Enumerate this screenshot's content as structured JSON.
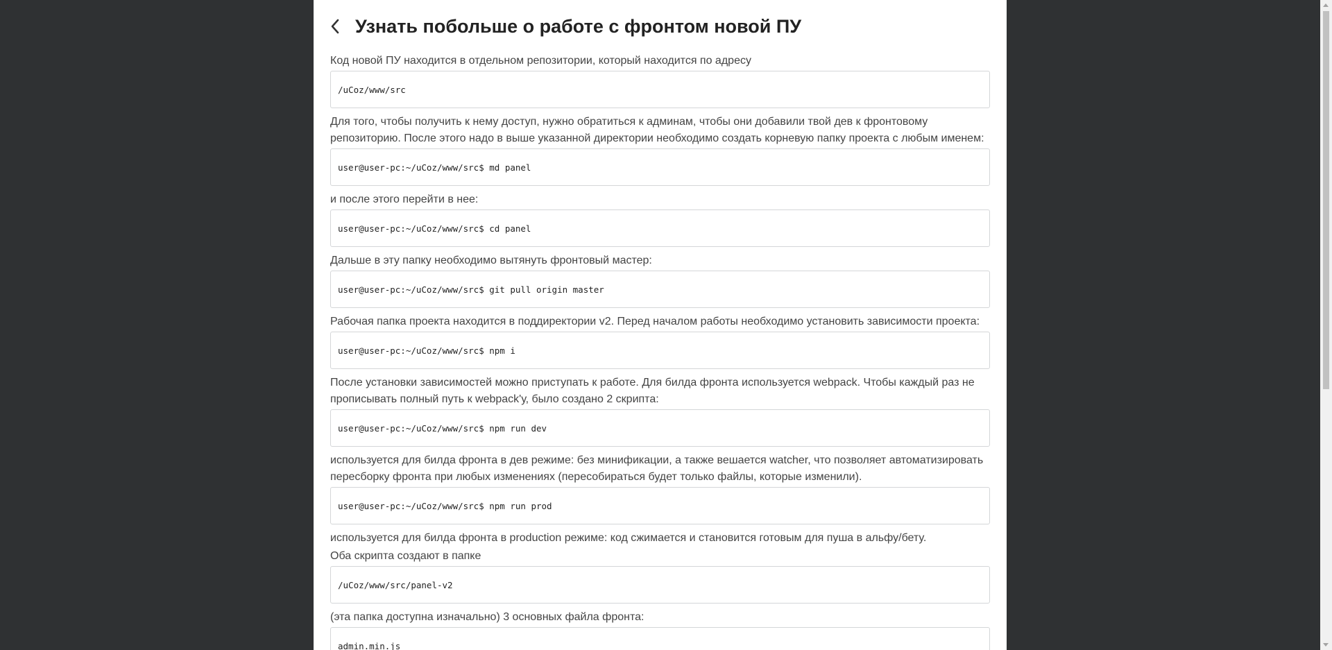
{
  "header": {
    "title": "Узнать побольше о работе с фронтом новой ПУ",
    "back_icon": "chevron-left-icon"
  },
  "blocks": [
    {
      "type": "text",
      "value": "Код новой ПУ находится в отдельном репозитории, который находится по адресу"
    },
    {
      "type": "code",
      "value": "/uCoz/www/src"
    },
    {
      "type": "text",
      "value": "Для того, чтобы получить к нему доступ, нужно обратиться к админам, чтобы они добавили твой дев к фронтовому репозиторию. После этого надо в выше указанной директории необходимо создать корневую папку проекта с любым именем:"
    },
    {
      "type": "code",
      "value": "user@user-pc:~/uCoz/www/src$ md panel"
    },
    {
      "type": "text",
      "value": "и после этого перейти в нее:"
    },
    {
      "type": "code",
      "value": "user@user-pc:~/uCoz/www/src$ cd panel"
    },
    {
      "type": "text",
      "value": "Дальше в эту папку необходимо вытянуть фронтовый мастер:"
    },
    {
      "type": "code",
      "value": "user@user-pc:~/uCoz/www/src$ git pull origin master"
    },
    {
      "type": "text",
      "value": "Рабочая папка проекта находится в поддиректории v2. Перед началом работы необходимо установить зависимости проекта:"
    },
    {
      "type": "code",
      "value": "user@user-pc:~/uCoz/www/src$ npm i"
    },
    {
      "type": "text",
      "value": "После установки зависимостей можно приступать к работе. Для билда фронта используется webpack. Чтобы каждый раз не прописывать полный путь к webpack'у, было создано 2 скрипта:"
    },
    {
      "type": "code",
      "value": "user@user-pc:~/uCoz/www/src$ npm run dev"
    },
    {
      "type": "text",
      "value": "используется для билда фронта в дев режиме: без минификации, а также вешается watcher, что позволяет автоматизировать пересборку фронта при любых изменениях (пересобираться будет только файлы, которые изменили)."
    },
    {
      "type": "code",
      "value": "user@user-pc:~/uCoz/www/src$ npm run prod"
    },
    {
      "type": "text",
      "value": "используется для билда фронта в production режиме: код сжимается и становится готовым для пуша в альфу/бету."
    },
    {
      "type": "text",
      "value": "Оба скрипта создают в папке"
    },
    {
      "type": "code",
      "value": "/uCoz/www/src/panel-v2"
    },
    {
      "type": "text",
      "value": "(эта папка доступна изначально) 3 основных файла фронта:"
    },
    {
      "type": "code",
      "value": "admin.min.js"
    }
  ],
  "colors": {
    "background": "#2f3133",
    "page": "#ffffff",
    "code_border": "#d4d6d8"
  }
}
